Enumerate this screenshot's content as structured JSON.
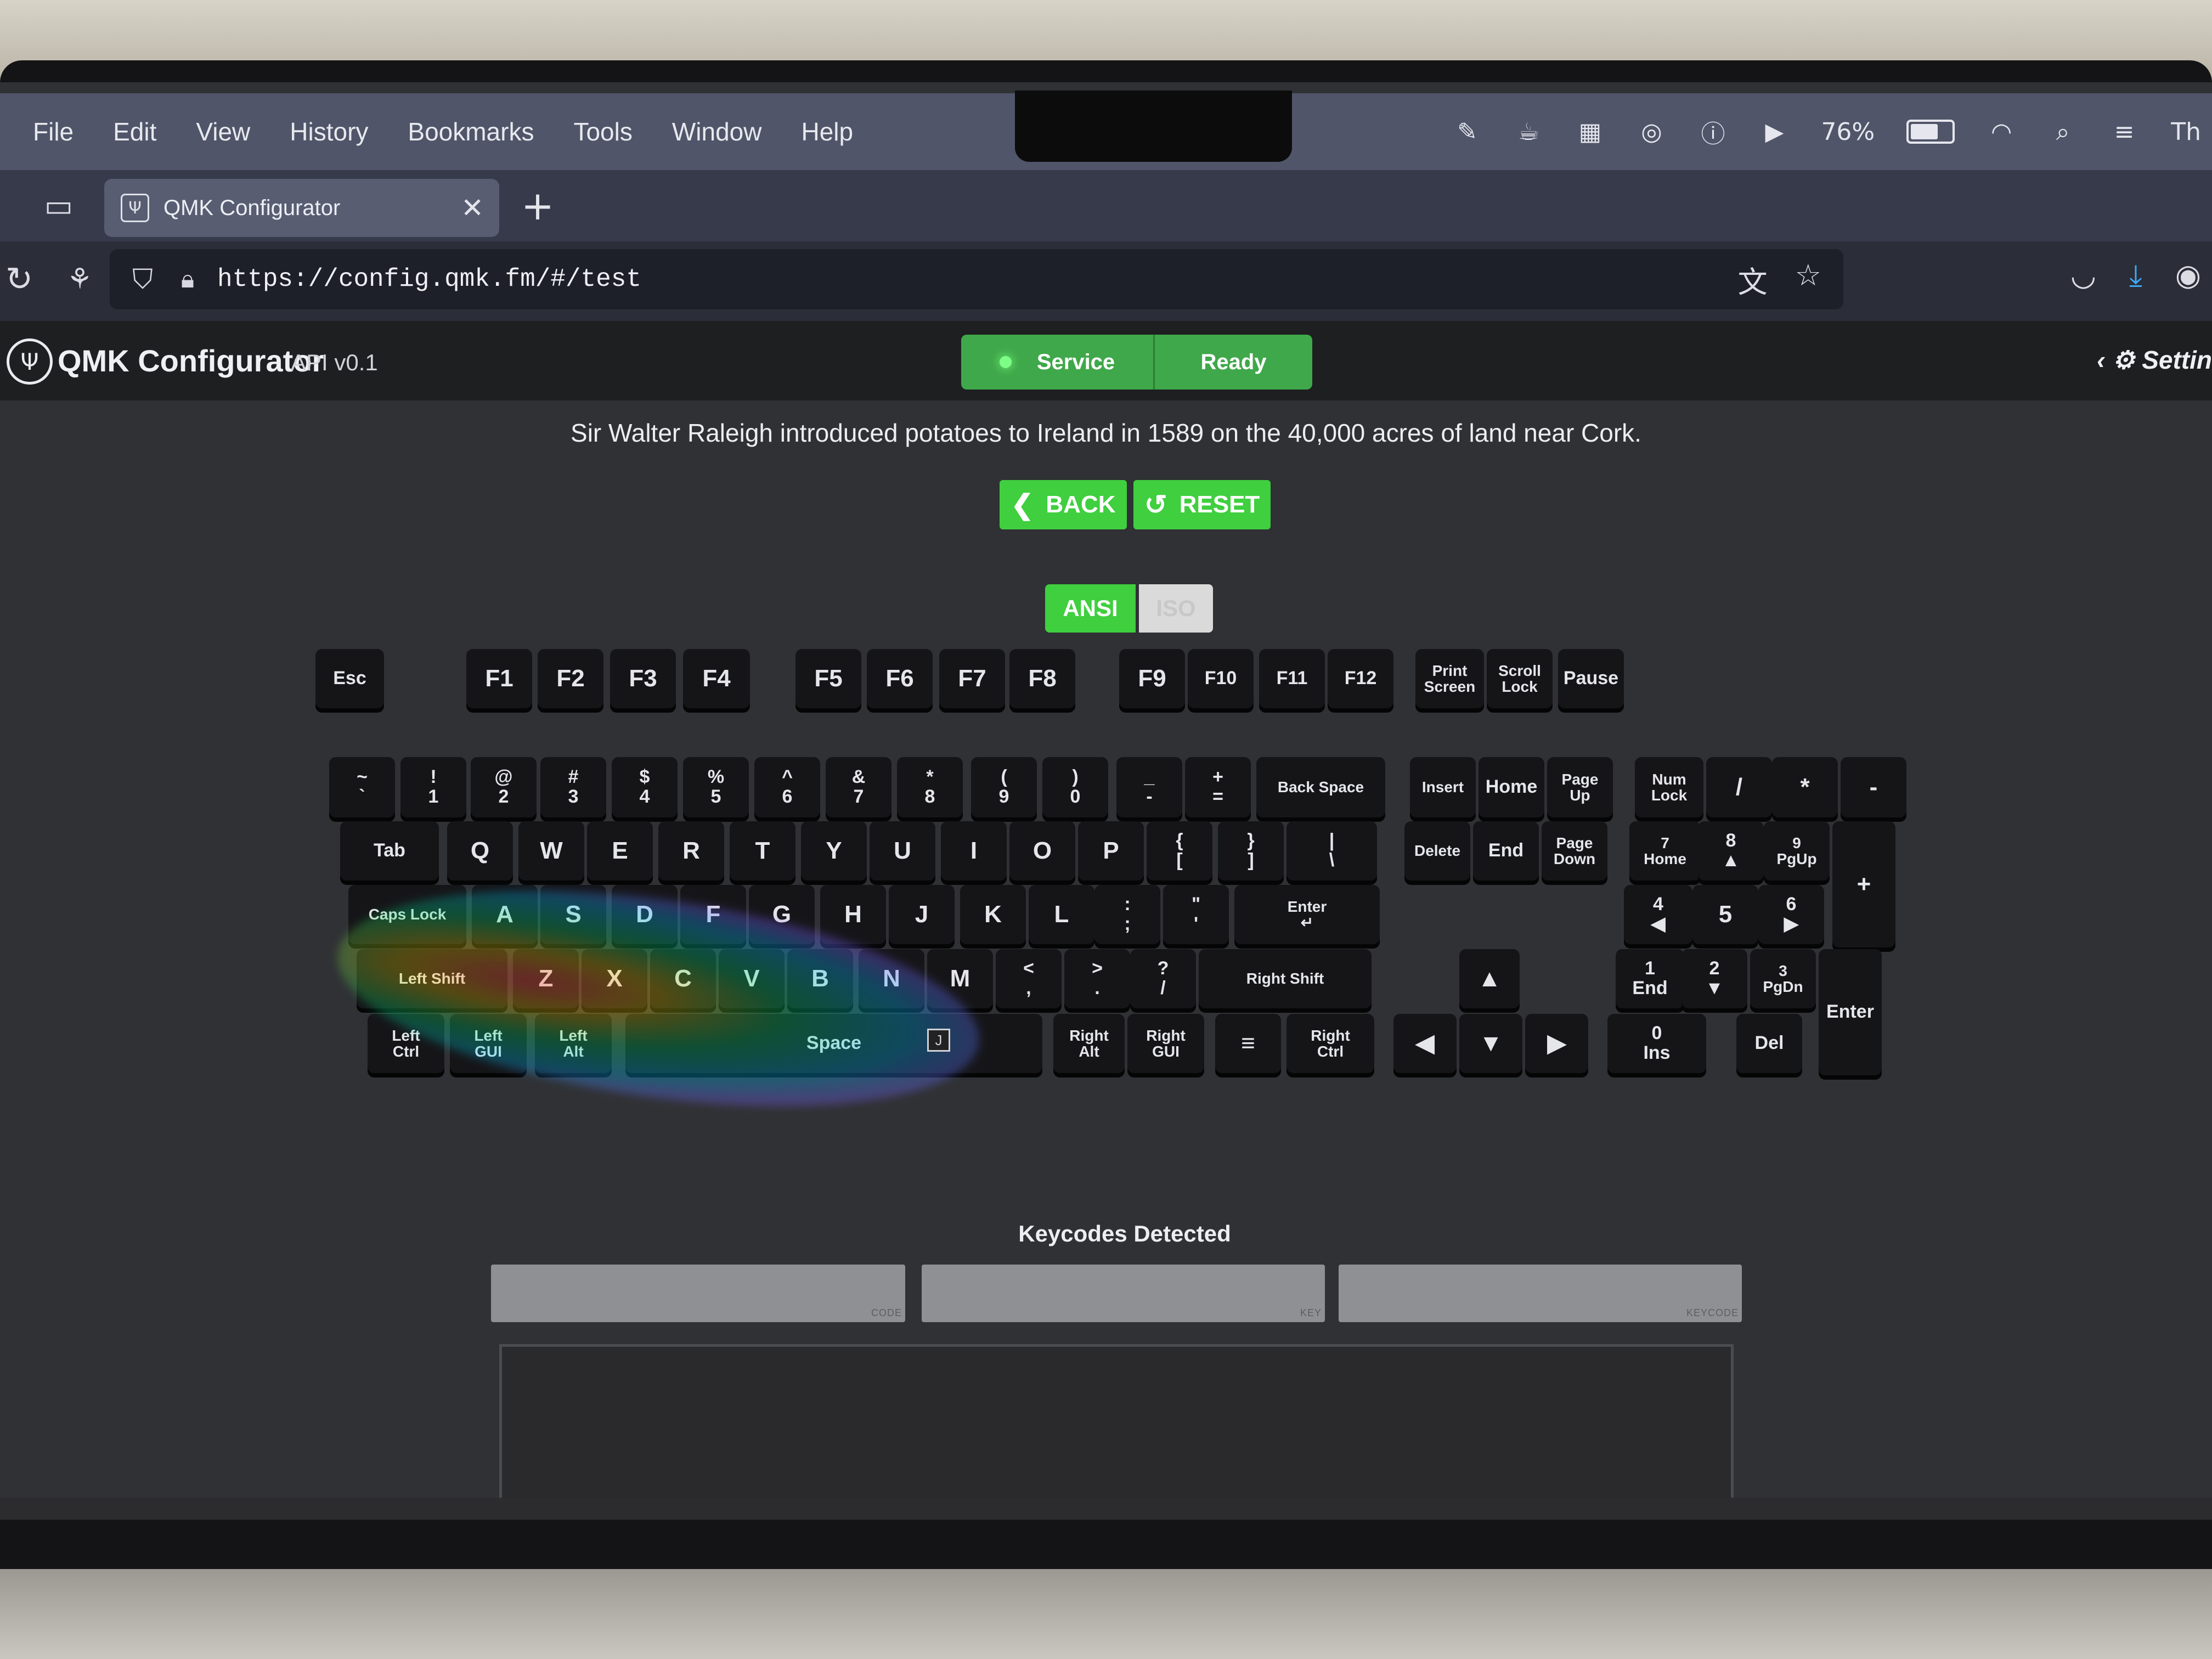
{
  "menubar": {
    "items": [
      "File",
      "Edit",
      "View",
      "History",
      "Bookmarks",
      "Tools",
      "Window",
      "Help"
    ],
    "battery_percent": "76%",
    "battery_level": 0.76,
    "status_icons": [
      "pen-icon",
      "coffee-icon",
      "grid-icon",
      "airdrop-icon",
      "alert-icon",
      "play-icon",
      "battery-icon",
      "wifi-icon",
      "search-icon",
      "control-center-icon"
    ],
    "trailing_text": "Th"
  },
  "browser": {
    "tab_title": "QMK Configurator",
    "url": "https://config.qmk.fm/#/test"
  },
  "app": {
    "title": "QMK Configurator",
    "version": "API v0.1",
    "service_label": "Service",
    "ready_label": "Ready",
    "settings_label": "Settin",
    "fact": "Sir Walter Raleigh introduced potatoes to Ireland in 1589 on the 40,000 acres of land near Cork.",
    "back_label": "BACK",
    "reset_label": "RESET",
    "ansi_label": "ANSI",
    "iso_label": "ISO",
    "tooltip_key": "J",
    "keycodes_title": "Keycodes Detected",
    "field_code": "CODE",
    "field_key": "KEY",
    "field_keycode": "KEYCODE",
    "accent_green": "#3fcf3f"
  },
  "keyboard": {
    "function_row": [
      "Esc",
      "F1",
      "F2",
      "F3",
      "F4",
      "F5",
      "F6",
      "F7",
      "F8",
      "F9",
      "F10",
      "F11",
      "F12",
      "Print\nScreen",
      "Scroll\nLock",
      "Pause"
    ],
    "number_row": [
      "~\n`",
      "!\n1",
      "@\n2",
      "#\n3",
      "$\n4",
      "%\n5",
      "^\n6",
      "&\n7",
      "*\n8",
      "(\n9",
      ")\n0",
      "_\n-",
      "+\n=",
      "Back Space",
      "Insert",
      "Home",
      "Page\nUp",
      "Num\nLock",
      "/",
      "*",
      "-"
    ],
    "tab_row": [
      "Tab",
      "Q",
      "W",
      "E",
      "R",
      "T",
      "Y",
      "U",
      "I",
      "O",
      "P",
      "{\n[",
      "}\n]",
      "|\n\\",
      "Delete",
      "End",
      "Page\nDown",
      "7\nHome",
      "8\n▲",
      "9\nPgUp",
      "+"
    ],
    "caps_row": [
      "Caps Lock",
      "A",
      "S",
      "D",
      "F",
      "G",
      "H",
      "J",
      "K",
      "L",
      ":\n;",
      "\"\n'",
      "Enter\n↵",
      "4\n◀",
      "5",
      "6\n▶"
    ],
    "shift_row": [
      "Left Shift",
      "Z",
      "X",
      "C",
      "V",
      "B",
      "N",
      "M",
      "<\n,",
      ">\n.",
      "?\n/",
      "Right Shift",
      "▲",
      "1\nEnd",
      "2\n▼",
      "3\nPgDn",
      "Enter"
    ],
    "bottom_row": [
      "Left\nCtrl",
      "Left\nGUI",
      "Left\nAlt",
      "Space",
      "Right\nAlt",
      "Right\nGUI",
      "≡",
      "Right\nCtrl",
      "◀",
      "▼",
      "▶",
      "0\nIns",
      "Del"
    ]
  }
}
